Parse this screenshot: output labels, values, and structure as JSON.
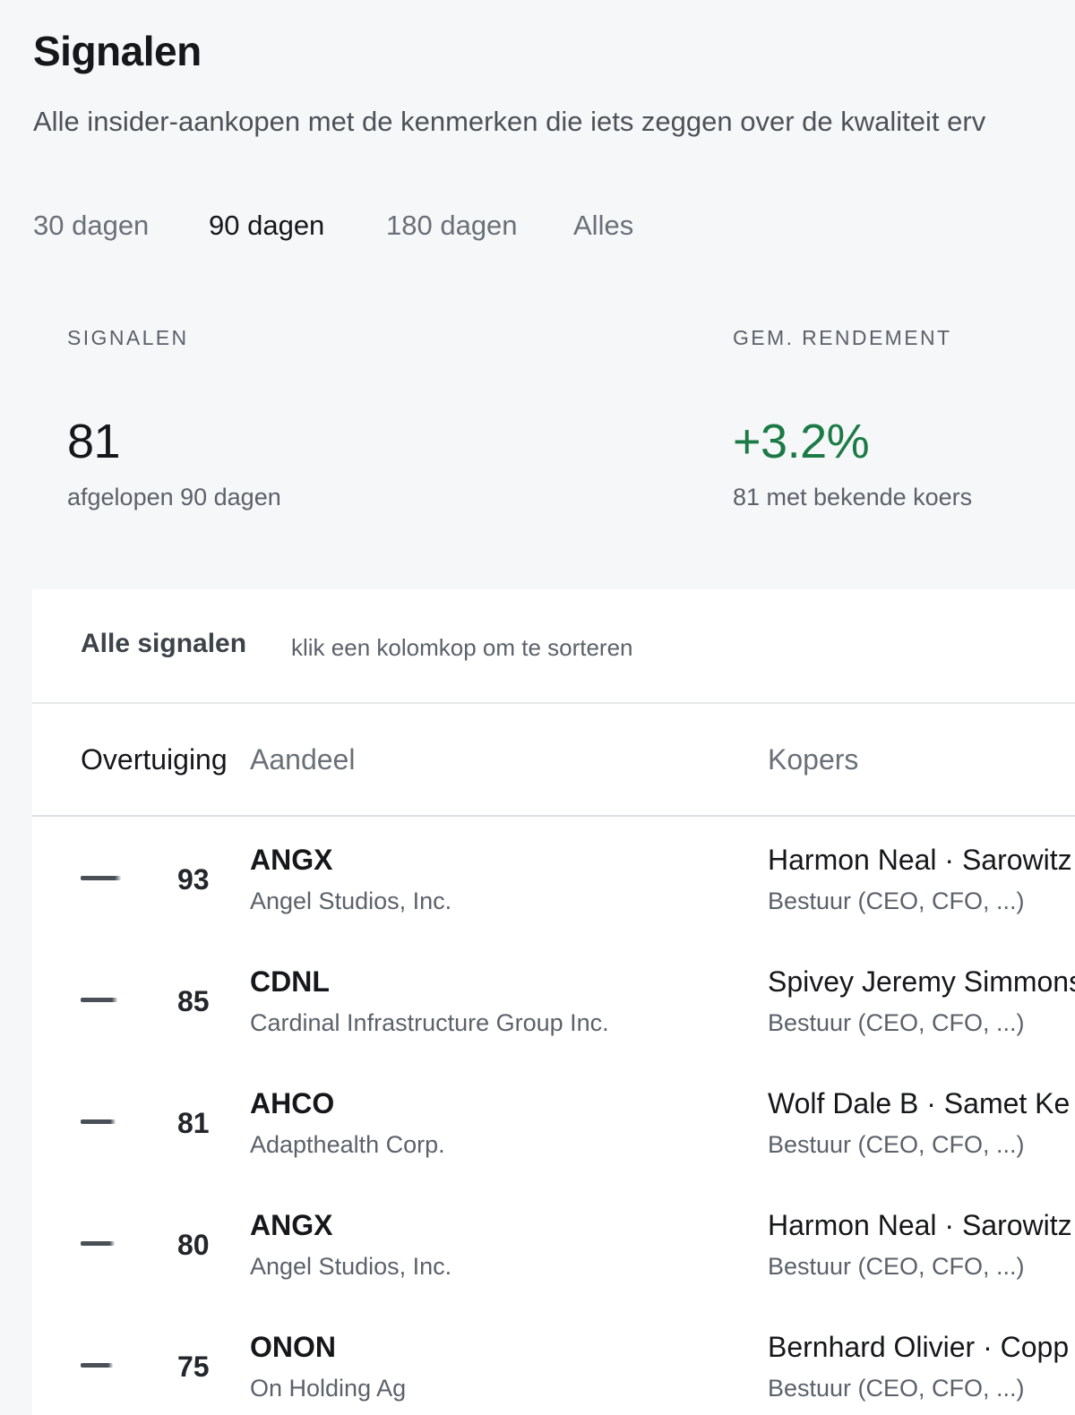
{
  "header": {
    "title": "Signalen",
    "subtitle": "Alle insider-aankopen met de kenmerken die iets zeggen over de kwaliteit erv"
  },
  "range_tabs": [
    {
      "label": "30 dagen",
      "active": false
    },
    {
      "label": "90 dagen",
      "active": true
    },
    {
      "label": "180 dagen",
      "active": false
    },
    {
      "label": "Alles",
      "active": false
    }
  ],
  "stats": {
    "signals": {
      "label": "SIGNALEN",
      "value": "81",
      "note": "afgelopen 90 dagen"
    },
    "return": {
      "label": "GEM. RENDEMENT",
      "value": "+3.2%",
      "note": "81 met bekende koers",
      "color": "#1b7a45"
    }
  },
  "panel": {
    "title": "Alle signalen",
    "hint": "klik een kolomkop om te sorteren",
    "columns": {
      "conviction": "Overtuiging",
      "stock": "Aandeel",
      "buyers": "Kopers"
    },
    "rows": [
      {
        "score": "93",
        "ticker": "ANGX",
        "company": "Angel Studios, Inc.",
        "buyers": "Harmon Neal · Sarowitz",
        "role": "Bestuur (CEO, CFO, ...)",
        "level": 0.93
      },
      {
        "score": "85",
        "ticker": "CDNL",
        "company": "Cardinal Infrastructure Group Inc.",
        "buyers": "Spivey Jeremy Simmons",
        "role": "Bestuur (CEO, CFO, ...)",
        "level": 0.85
      },
      {
        "score": "81",
        "ticker": "AHCO",
        "company": "Adapthealth Corp.",
        "buyers": "Wolf Dale B · Samet Ke",
        "role": "Bestuur (CEO, CFO, ...)",
        "level": 0.81
      },
      {
        "score": "80",
        "ticker": "ANGX",
        "company": "Angel Studios, Inc.",
        "buyers": "Harmon Neal · Sarowitz",
        "role": "Bestuur (CEO, CFO, ...)",
        "level": 0.8
      },
      {
        "score": "75",
        "ticker": "ONON",
        "company": "On Holding Ag",
        "buyers": "Bernhard Olivier · Copp",
        "role": "Bestuur (CEO, CFO, ...)",
        "level": 0.75
      }
    ]
  }
}
